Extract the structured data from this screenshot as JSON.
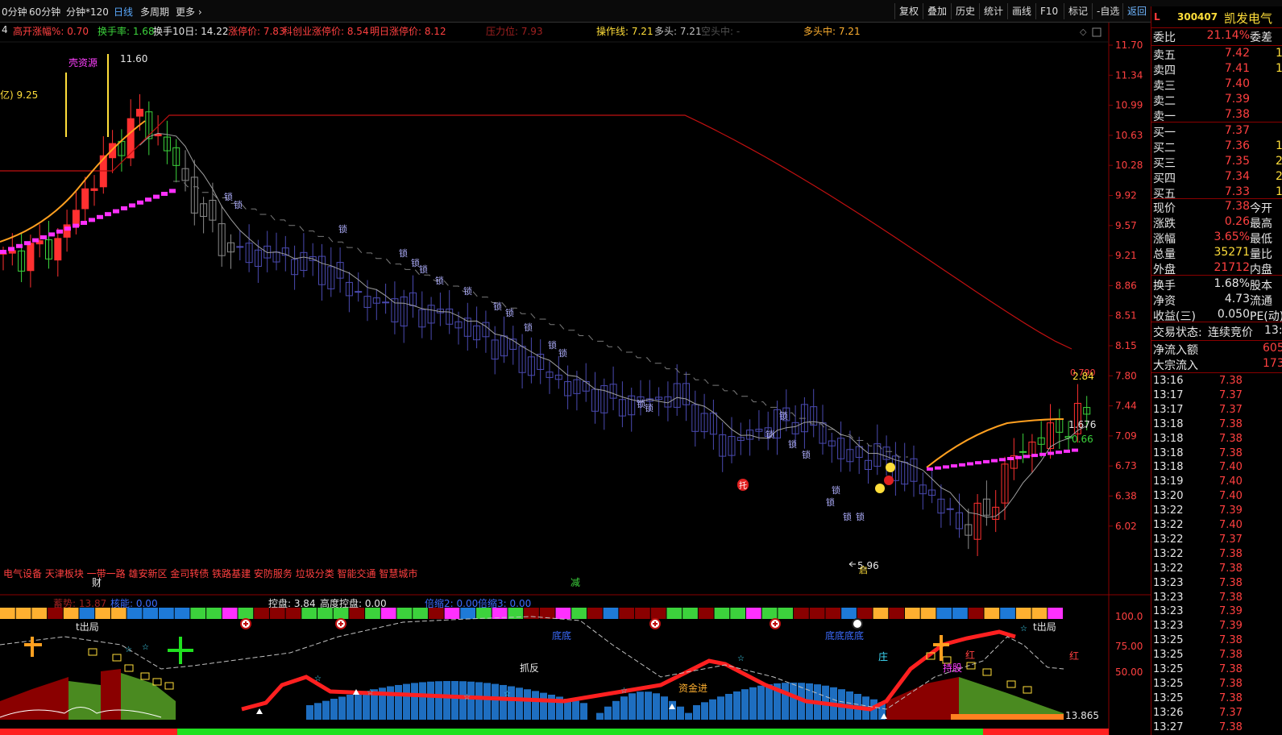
{
  "toolbar": {
    "timeframes": [
      "0分钟",
      "60分钟",
      "分钟*120",
      "日线",
      "多周期",
      "更多"
    ],
    "buttons": [
      "复权",
      "叠加",
      "历史",
      "统计",
      "画线",
      "F10",
      "标记",
      "-自选",
      "返回"
    ]
  },
  "indicator_line": [
    {
      "text": "4",
      "color": "#e0e0e0"
    },
    {
      "text": "高开涨幅%: 0.70",
      "color": "#ff4040"
    },
    {
      "text": "换手率: 1.68",
      "color": "#3cd23c"
    },
    {
      "text": "换手10日: 14.22",
      "color": "#e6e6e6"
    },
    {
      "text": "涨停价: 7.83",
      "color": "#ff4040"
    },
    {
      "text": "科创业涨停价: 8.54",
      "color": "#ff4040"
    },
    {
      "text": "明日涨停价: 8.12",
      "color": "#ff4040"
    },
    {
      "text": "压力位: 7.93",
      "color": "#a02020"
    },
    {
      "text": "操作线: 7.21",
      "color": "#ffde3a"
    },
    {
      "text": "多头: 7.21",
      "color": "#c0c0c0"
    },
    {
      "text": "空头中: -",
      "color": "#505050"
    },
    {
      "text": "多头中: 7.21",
      "color": "#ffb030"
    }
  ],
  "price_axis": [
    "11.70",
    "11.34",
    "10.99",
    "10.63",
    "10.28",
    "9.92",
    "9.57",
    "9.21",
    "8.86",
    "8.51",
    "8.15",
    "7.80",
    "7.44",
    "7.09",
    "6.73",
    "6.38",
    "6.02"
  ],
  "sub_axis": [
    "100.0",
    "75.00",
    "50.00",
    "13.865"
  ],
  "chart_labels": {
    "high_label": "11.60",
    "shell": "壳资源",
    "left_val": "亿) 9.25",
    "low_label": "5.96",
    "right_a": "2.84",
    "right_b": "1.676",
    "right_c": "0.66",
    "right_d": "0.790",
    "concepts": "电气设备 天津板块 一带一路 雄安新区 金司转债 铁路基建 安防服务 垃圾分类 智能交通 智慧城市",
    "cai": "财",
    "jian": "减",
    "tuo": "托",
    "qi": "启",
    "suo": "锁"
  },
  "sub_indicator_line": [
    {
      "text": "蓄势: 13.87",
      "color": "#a02020"
    },
    {
      "text": "核能: 0.00",
      "color": "#3c6cff"
    },
    {
      "text": "控盘: 3.84",
      "color": "#e6e6e6"
    },
    {
      "text": "高度控盘: 0.00",
      "color": "#e6e6e6"
    },
    {
      "text": "倍缩2: 0.00",
      "color": "#3c6cff"
    },
    {
      "text": "倍缩3: 0.00",
      "color": "#3c6cff"
    }
  ],
  "sub_labels": {
    "out_left": "t出局",
    "out_right": "t出局",
    "zhuafan": "抓反",
    "dd1": "底底",
    "dd2": "底底底底",
    "zhuang": "庄",
    "hong1": "红",
    "hong2": "红",
    "chigu": "持股",
    "zijin": "资金进"
  },
  "quote": {
    "flag": "L",
    "code": "300407",
    "name": "凯发电气",
    "weibi": {
      "k": "委比",
      "v": "21.14%",
      "k2": "委差"
    },
    "sells": [
      {
        "k": "卖五",
        "v": "7.42",
        "n": "1"
      },
      {
        "k": "卖四",
        "v": "7.41",
        "n": "1"
      },
      {
        "k": "卖三",
        "v": "7.40",
        "n": ""
      },
      {
        "k": "卖二",
        "v": "7.39",
        "n": ""
      },
      {
        "k": "卖一",
        "v": "7.38",
        "n": ""
      }
    ],
    "buys": [
      {
        "k": "买一",
        "v": "7.37",
        "n": ""
      },
      {
        "k": "买二",
        "v": "7.36",
        "n": "1"
      },
      {
        "k": "买三",
        "v": "7.35",
        "n": "2"
      },
      {
        "k": "买四",
        "v": "7.34",
        "n": "2"
      },
      {
        "k": "买五",
        "v": "7.33",
        "n": "1"
      }
    ],
    "stats": [
      {
        "k": "现价",
        "v": "7.38",
        "c": "#ff4040",
        "k2": "今开"
      },
      {
        "k": "涨跌",
        "v": "0.26",
        "c": "#ff4040",
        "k2": "最高"
      },
      {
        "k": "涨幅",
        "v": "3.65%",
        "c": "#ff4040",
        "k2": "最低"
      },
      {
        "k": "总量",
        "v": "35271",
        "c": "#ffde3a",
        "k2": "量比"
      },
      {
        "k": "外盘",
        "v": "21712",
        "c": "#ff4040",
        "k2": "内盘"
      }
    ],
    "stats2": [
      {
        "k": "换手",
        "v": "1.68%",
        "c": "#e6e6e6",
        "k2": "股本"
      },
      {
        "k": "净资",
        "v": "4.73",
        "c": "#e6e6e6",
        "k2": "流通"
      },
      {
        "k": "收益(三)",
        "v": "0.050",
        "c": "#e6e6e6",
        "k2": "PE(动)"
      }
    ],
    "state": {
      "k": "交易状态:",
      "v": "连续竞价",
      "t": "13:2"
    },
    "flow": [
      {
        "k": "净流入额",
        "v": "605"
      },
      {
        "k": "大宗流入",
        "v": "173"
      }
    ],
    "ticks": [
      {
        "t": "13:16",
        "p": "7.38"
      },
      {
        "t": "13:17",
        "p": "7.37"
      },
      {
        "t": "13:17",
        "p": "7.37"
      },
      {
        "t": "13:18",
        "p": "7.38"
      },
      {
        "t": "13:18",
        "p": "7.38"
      },
      {
        "t": "13:18",
        "p": "7.38"
      },
      {
        "t": "13:18",
        "p": "7.40"
      },
      {
        "t": "13:19",
        "p": "7.40"
      },
      {
        "t": "13:20",
        "p": "7.40"
      },
      {
        "t": "13:22",
        "p": "7.39"
      },
      {
        "t": "13:22",
        "p": "7.40"
      },
      {
        "t": "13:22",
        "p": "7.37"
      },
      {
        "t": "13:22",
        "p": "7.38"
      },
      {
        "t": "13:22",
        "p": "7.38"
      },
      {
        "t": "13:23",
        "p": "7.38"
      },
      {
        "t": "13:23",
        "p": "7.38"
      },
      {
        "t": "13:23",
        "p": "7.39"
      },
      {
        "t": "13:23",
        "p": "7.39"
      },
      {
        "t": "13:25",
        "p": "7.38"
      },
      {
        "t": "13:25",
        "p": "7.38"
      },
      {
        "t": "13:25",
        "p": "7.38"
      },
      {
        "t": "13:25",
        "p": "7.38"
      },
      {
        "t": "13:25",
        "p": "7.38"
      },
      {
        "t": "13:26",
        "p": "7.37"
      },
      {
        "t": "13:27",
        "p": "7.38"
      }
    ]
  }
}
